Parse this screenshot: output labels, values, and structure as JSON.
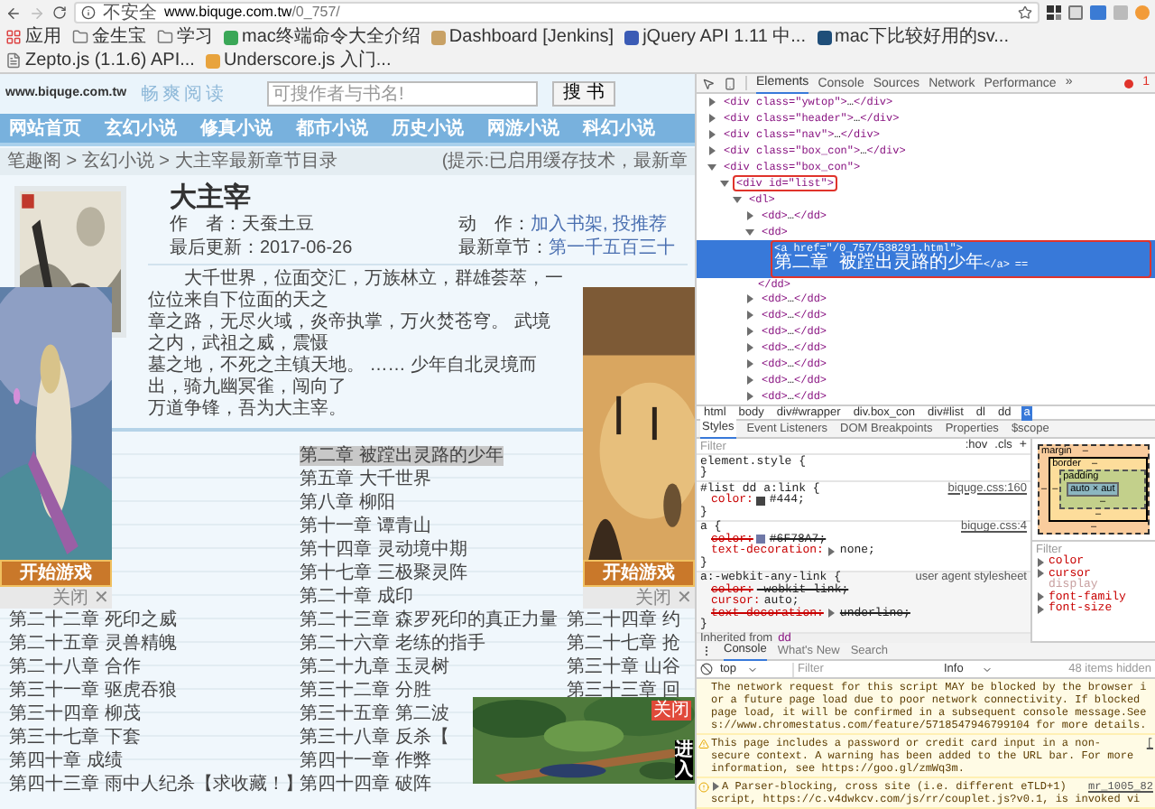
{
  "browser": {
    "security": "不安全",
    "url_host": "www.biquge.com.tw",
    "url_path": "/0_757/"
  },
  "bookmarks": [
    {
      "label": "应用",
      "kind": "apps"
    },
    {
      "label": "金生宝",
      "kind": "folder"
    },
    {
      "label": "学习",
      "kind": "folder"
    },
    {
      "label": "mac终端命令大全介绍",
      "kind": "page",
      "color": "#3aa757"
    },
    {
      "label": "Dashboard [Jenkins]",
      "kind": "page",
      "color": "#c8a165"
    },
    {
      "label": "jQuery API 1.11 中...",
      "kind": "page",
      "color": "#3b5bb5"
    },
    {
      "label": "mac下比较好用的sv...",
      "kind": "page",
      "color": "#1f4e79"
    },
    {
      "label": "Zepto.js (1.1.6) API...",
      "kind": "doc"
    },
    {
      "label": "Underscore.js 入门...",
      "kind": "page",
      "color": "#e8a33d"
    }
  ],
  "site": {
    "domain": "www.biquge.com.tw",
    "slogan": "畅爽阅读",
    "search": {
      "placeholder": "可搜作者与书名!"
    },
    "search_button": "搜 书",
    "nav": [
      "网站首页",
      "玄幻小说",
      "修真小说",
      "都市小说",
      "历史小说",
      "网游小说",
      "科幻小说"
    ],
    "breadcrumb": "笔趣阁 > 玄幻小说 > 大主宰最新章节目录",
    "notice": "(提示:已启用缓存技术，最新章",
    "book": {
      "title": "大主宰",
      "meta": [
        {
          "label": "作　者：",
          "value": "天蚕土豆",
          "kind": "plain"
        },
        {
          "label": "动　作：",
          "value": "加入书架, 投推荐",
          "kind": "link"
        },
        {
          "label": "最后更新：",
          "value": "2017-06-26",
          "kind": "plain"
        },
        {
          "label": "最新章节：",
          "value": "第一千五百三十",
          "kind": "link"
        }
      ],
      "description": [
        "大千世界，位面交汇，万族林立，群雄荟萃，一位位来自下位面的天之",
        "章之路，无尽火域，炎帝执掌，万火焚苍穹。 武境之内，武祖之威，震慑",
        "墓之地，不死之主镇天地。 …… 少年自北灵境而出，骑九幽冥雀，闯向了",
        "万道争锋，吾为大主宰。"
      ]
    },
    "chapters": [
      {
        "middle": "第二章 被蹚出灵路的少年",
        "selected": true
      },
      {
        "middle": "第五章 大千世界",
        "selected": false
      },
      {
        "middle": "第八章 柳阳",
        "selected": false
      },
      {
        "middle": "第十一章 谭青山",
        "selected": false
      },
      {
        "middle": "第十四章 灵动境中期",
        "selected": false
      },
      {
        "middle": "第十七章 三极聚灵阵",
        "selected": false
      },
      {
        "middle": "第二十章 成印",
        "selected": false
      },
      {
        "left": "第二十二章 死印之威",
        "middle": "第二十三章 森罗死印的真正力量",
        "right": "第二十四章 约",
        "selected": false
      },
      {
        "left": "第二十五章 灵兽精魄",
        "middle": "第二十六章 老练的指手",
        "right": "第二十七章 抢",
        "selected": false
      },
      {
        "left": "第二十八章 合作",
        "middle": "第二十九章 玉灵树",
        "right": "第三十章 山谷",
        "selected": false
      },
      {
        "left": "第三十一章 驱虎吞狼",
        "middle": "第三十二章 分胜",
        "right": "第三十三章 回",
        "selected": false
      },
      {
        "left": "第三十四章 柳茂",
        "middle": "第三十五章 第二波",
        "selected": false
      },
      {
        "left": "第三十七章 下套",
        "middle": "第三十八章 反杀【",
        "selected": false
      },
      {
        "left": "第四十章 成绩",
        "middle": "第四十一章 作弊",
        "selected": false
      },
      {
        "left": "第四十三章 雨中人纪杀【求收藏！】",
        "middle": "第四十四章 破阵",
        "selected": false
      }
    ],
    "side_ads": [
      {
        "kind": "fantasy",
        "button": "开始游戏",
        "close": "关闭 ✕"
      },
      {
        "kind": "desert",
        "button": "开始游戏",
        "close": "关闭 ✕"
      }
    ],
    "video_ad": {
      "close": "关闭",
      "enter": "进入"
    }
  },
  "devtools": {
    "tabs": [
      {
        "label": "Elements",
        "selected": true
      },
      {
        "label": "Console",
        "selected": false
      },
      {
        "label": "Sources",
        "selected": false
      },
      {
        "label": "Network",
        "selected": false
      },
      {
        "label": "Performance",
        "selected": false
      }
    ],
    "more": "»",
    "error_count": "1",
    "dom": [
      {
        "open": "<div class=\"ywtop\">",
        "inner": "…",
        "close": "</div>",
        "expanded": false,
        "selected": false
      },
      {
        "open": "<div class=\"header\">",
        "inner": "…",
        "close": "</div>",
        "expanded": false,
        "selected": false
      },
      {
        "open": "<div class=\"nav\">",
        "inner": "…",
        "close": "</div>",
        "expanded": false,
        "selected": false
      },
      {
        "open": "<div class=\"box_con\">",
        "inner": "…",
        "close": "</div>",
        "expanded": false,
        "selected": false
      },
      {
        "open": "<div class=\"box_con\">",
        "expanded": true,
        "selected": false,
        "children": [
          {
            "open": "<div id=\"list\">",
            "expanded": true,
            "selected": false,
            "outlined": true,
            "children": [
              {
                "open": "<dl>",
                "expanded": true,
                "selected": false,
                "children": [
                  {
                    "open": "<dd>",
                    "inner": "…",
                    "close": "</dd>",
                    "expanded": false,
                    "selected": false
                  },
                  {
                    "open": "<dd>",
                    "close": "</dd>",
                    "expanded": true,
                    "selected": false,
                    "children": [
                      {
                        "open": "<a href=\"/0_757/538291.html\">",
                        "inner": "第二章 被蹚出灵路的少年",
                        "close": "</a>",
                        "suffix": "==",
                        "selected": true,
                        "outlined": true
                      }
                    ]
                  },
                  {
                    "open": "<dd>",
                    "inner": "…",
                    "close": "</dd>",
                    "expanded": false,
                    "selected": false
                  },
                  {
                    "open": "<dd>",
                    "inner": "…",
                    "close": "</dd>",
                    "expanded": false,
                    "selected": false
                  },
                  {
                    "open": "<dd>",
                    "inner": "…",
                    "close": "</dd>",
                    "expanded": false,
                    "selected": false
                  },
                  {
                    "open": "<dd>",
                    "inner": "…",
                    "close": "</dd>",
                    "expanded": false,
                    "selected": false
                  },
                  {
                    "open": "<dd>",
                    "inner": "…",
                    "close": "</dd>",
                    "expanded": false,
                    "selected": false
                  },
                  {
                    "open": "<dd>",
                    "inner": "…",
                    "close": "</dd>",
                    "expanded": false,
                    "selected": false
                  },
                  {
                    "open": "<dd>",
                    "inner": "…",
                    "close": "</dd>",
                    "expanded": false,
                    "selected": false
                  }
                ]
              }
            ]
          }
        ]
      }
    ],
    "path": [
      {
        "label": "html",
        "selected": false
      },
      {
        "label": "body",
        "selected": false
      },
      {
        "label": "div#wrapper",
        "selected": false
      },
      {
        "label": "div.box_con",
        "selected": false
      },
      {
        "label": "div#list",
        "selected": false
      },
      {
        "label": "dl",
        "selected": false
      },
      {
        "label": "dd",
        "selected": false
      },
      {
        "label": "a",
        "selected": true
      }
    ],
    "style_tabs": [
      {
        "label": "Styles",
        "selected": true
      },
      {
        "label": "Event Listeners",
        "selected": false
      },
      {
        "label": "DOM Breakpoints",
        "selected": false
      },
      {
        "label": "Properties",
        "selected": false
      },
      {
        "label": "$scope",
        "selected": false
      }
    ],
    "styles_filter": {
      "placeholder": "Filter"
    },
    "hov": ":hov",
    "cls": ".cls",
    "add": "+",
    "rules": [
      {
        "selector": "element.style {",
        "close": "}",
        "kind": "author"
      },
      {
        "selector": "#list dd a:link {",
        "source": "biquge.css:160",
        "close": "}",
        "kind": "author",
        "declarations": [
          {
            "name": "color:",
            "value": "#444;",
            "color": "#444444",
            "struck": false
          }
        ]
      },
      {
        "selector": "a {",
        "source": "biquge.css:4",
        "close": "}",
        "kind": "author",
        "declarations": [
          {
            "name": "color:",
            "value": "#6F78A7;",
            "color": "#6f78a7",
            "struck": true
          },
          {
            "name": "text-decoration:",
            "value": "none;",
            "expandable": true,
            "struck": false
          }
        ]
      },
      {
        "selector": "a:-webkit-any-link {",
        "source": "user agent stylesheet",
        "close": "}",
        "kind": "user-agent",
        "declarations": [
          {
            "name": "color:",
            "value": "-webkit-link;",
            "struck": true
          },
          {
            "name": "cursor:",
            "value": "auto;",
            "struck": false
          },
          {
            "name": "text-decoration:",
            "value": "underline;",
            "expandable": true,
            "struck": true
          }
        ]
      }
    ],
    "inherited_label": "Inherited from",
    "inherited_from": "dd",
    "box_model": {
      "margin": {
        "label": "margin",
        "top": "–",
        "left": "–",
        "bottom": "–"
      },
      "border": {
        "label": "border",
        "top": "–",
        "left": "–",
        "bottom": "–"
      },
      "padding": {
        "label": "padding",
        "bottom": "–"
      },
      "content": "auto × aut"
    },
    "computed_filter": {
      "placeholder": "Filter"
    },
    "computed": [
      {
        "name": "color",
        "expandable": true
      },
      {
        "name": "cursor",
        "expandable": true
      },
      {
        "name": "display",
        "expandable": false
      },
      {
        "name": "font-family",
        "expandable": true
      },
      {
        "name": "font-size",
        "expandable": true
      }
    ],
    "console": {
      "tabs": [
        {
          "label": "Console",
          "selected": true
        },
        {
          "label": "What's New",
          "selected": false
        },
        {
          "label": "Search",
          "selected": false
        }
      ],
      "context": "top",
      "filter": {
        "placeholder": "Filter"
      },
      "level": "Info",
      "hidden": "48 items hidden",
      "messages": [
        {
          "kind": "continuation",
          "lines": [
            "The network request for this script MAY be blocked by the browser i",
            "or a future page load due to poor network connectivity. If blocked",
            "page load, it will be confirmed in a subsequent console message.See",
            "s://www.chromestatus.com/feature/5718547946799104 for more details."
          ]
        },
        {
          "kind": "warning",
          "source": "[",
          "lines": [
            "This page includes a password or credit card input in a non-",
            "secure context. A warning has been added to the URL bar. For more",
            "information, see https://goo.gl/zmWq3m."
          ]
        },
        {
          "kind": "violation",
          "source": "mr_1005_82",
          "lines": [
            "A Parser-blocking, cross site (i.e. different eTLD+1)",
            "script, https://c.v4dwkcv.com/js/rr/couplet.js?v0.1, is invoked vi"
          ]
        }
      ]
    }
  }
}
